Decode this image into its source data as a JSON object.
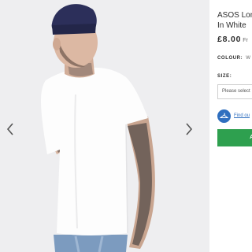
{
  "product": {
    "title_line1": "ASOS Lon",
    "title_line2": "In White",
    "price": "£8.00",
    "price_suffix": "Fr",
    "colour_label": "COLOUR:",
    "colour_value": "W",
    "size_label": "SIZE:",
    "size_placeholder": "Please select",
    "fit_link": "Find ou",
    "add_button": "AD"
  },
  "gallery": {
    "prev_icon": "chevron-left-icon",
    "next_icon": "chevron-right-icon",
    "image": "model-in-white-tshirt"
  },
  "colors": {
    "accent_green": "#2ea04f",
    "link_blue": "#2f6fbf",
    "gallery_bg": "#eeeef0"
  }
}
